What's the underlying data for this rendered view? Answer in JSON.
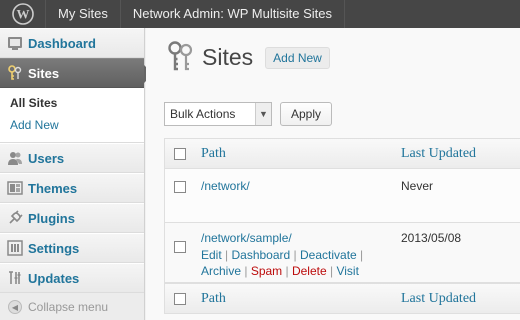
{
  "admin_bar": {
    "my_sites": "My Sites",
    "network_admin": "Network Admin: WP Multisite Sites"
  },
  "menu": {
    "dashboard": "Dashboard",
    "sites": "Sites",
    "sites_sub": {
      "all_sites": "All Sites",
      "add_new": "Add New"
    },
    "users": "Users",
    "themes": "Themes",
    "plugins": "Plugins",
    "settings": "Settings",
    "updates": "Updates",
    "collapse": "Collapse menu"
  },
  "page": {
    "title": "Sites",
    "add_new": "Add New"
  },
  "bulk": {
    "selected": "Bulk Actions",
    "apply": "Apply"
  },
  "table": {
    "columns": {
      "path": "Path",
      "last_updated": "Last Updated"
    },
    "rows": [
      {
        "path": "/network/",
        "last_updated": "Never"
      },
      {
        "path": "/network/sample/",
        "last_updated": "2013/05/08",
        "actions": {
          "edit": "Edit",
          "dashboard": "Dashboard",
          "deactivate": "Deactivate",
          "archive": "Archive",
          "spam": "Spam",
          "delete": "Delete",
          "visit": "Visit"
        }
      }
    ]
  },
  "icons": {
    "wp_logo": "wordpress-logo-icon",
    "dashboard": "dashboard-icon",
    "sites": "keys-icon",
    "users": "users-icon",
    "themes": "themes-icon",
    "plugins": "plugins-icon",
    "settings": "settings-icon",
    "updates": "updates-icon",
    "collapse": "collapse-arrow-icon"
  },
  "colors": {
    "admin_bar": "#464646",
    "link": "#21759b",
    "active_menu": "#6d6d6d",
    "danger": "#bc0b0b"
  }
}
